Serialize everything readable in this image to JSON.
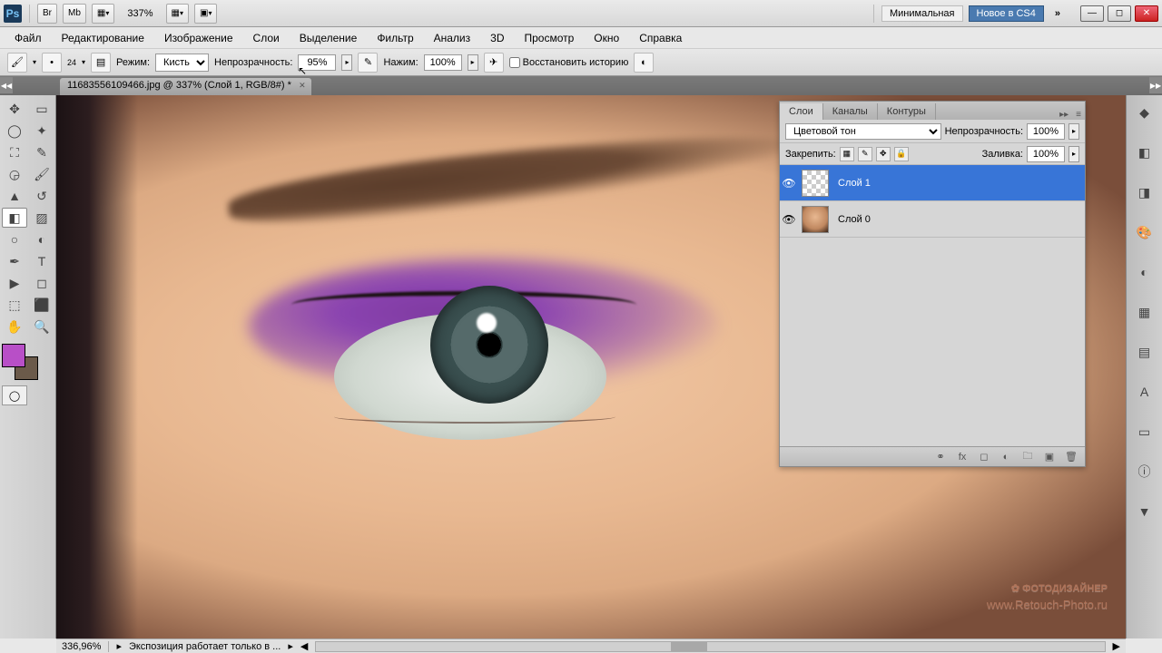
{
  "titlebar": {
    "bridge": "Br",
    "mb": "Mb",
    "zoom": "337%",
    "workspace_min": "Минимальная",
    "workspace_new": "Новое в CS4",
    "expand_chevrons": "»"
  },
  "menu": {
    "file": "Файл",
    "edit": "Редактирование",
    "image": "Изображение",
    "layer": "Слои",
    "select": "Выделение",
    "filter": "Фильтр",
    "analysis": "Анализ",
    "3d": "3D",
    "view": "Просмотр",
    "window": "Окно",
    "help": "Справка"
  },
  "optbar": {
    "brush_size": "24",
    "mode_label": "Режим:",
    "mode_value": "Кисть",
    "opacity_label": "Непрозрачность:",
    "opacity_value": "95%",
    "flow_label": "Нажим:",
    "flow_value": "100%",
    "restore_history": " Восстановить историю"
  },
  "doctab": {
    "title": "11683556109466.jpg @ 337% (Слой 1, RGB/8#) *"
  },
  "colors": {
    "foreground": "#b84fc7",
    "background": "#6b5a4a"
  },
  "layers_panel": {
    "tab_layers": "Слои",
    "tab_channels": "Каналы",
    "tab_paths": "Контуры",
    "blend_mode": "Цветовой тон",
    "opacity_label": "Непрозрачность:",
    "opacity_value": "100%",
    "lock_label": "Закрепить:",
    "fill_label": "Заливка:",
    "fill_value": "100%",
    "layers": [
      {
        "name": "Слой 1",
        "selected": true,
        "thumb": "checker"
      },
      {
        "name": "Слой 0",
        "selected": false,
        "thumb": "face"
      }
    ]
  },
  "statusbar": {
    "zoom": "336,96%",
    "info": "Экспозиция работает только в ..."
  },
  "watermark": {
    "main": "✿ ФОТОДИЗАЙНЕР",
    "sub": "www.Retouch-Photo.ru"
  }
}
